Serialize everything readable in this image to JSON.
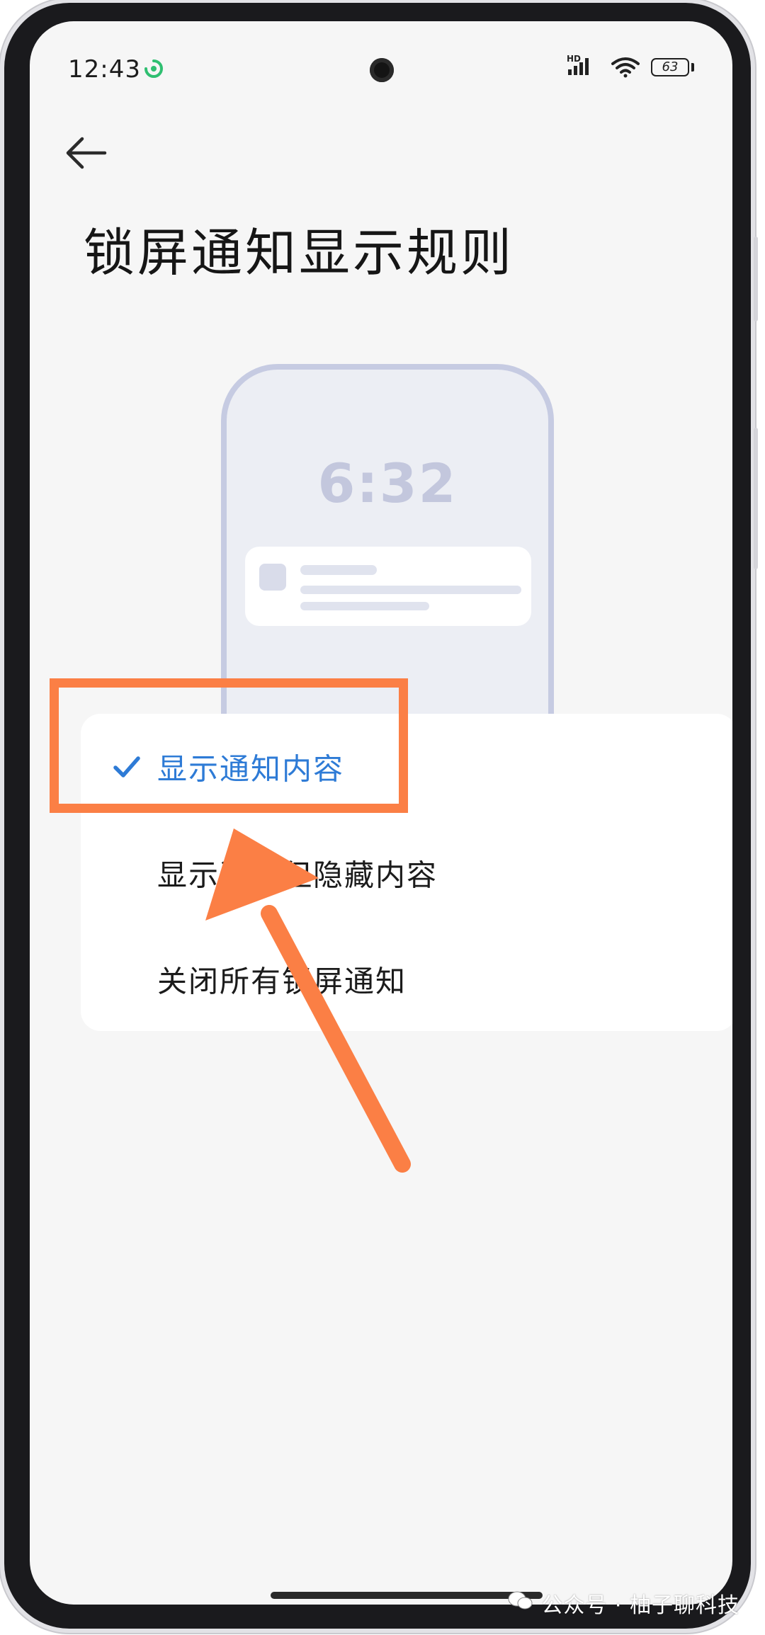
{
  "status_bar": {
    "time": "12:43",
    "network_label": "HD",
    "battery": "63"
  },
  "header": {
    "title": "锁屏通知显示规则"
  },
  "illustration": {
    "time": "6:32"
  },
  "options": [
    {
      "label": "显示通知内容",
      "selected": true
    },
    {
      "label": "显示通知但隐藏内容",
      "selected": false
    },
    {
      "label": "关闭所有锁屏通知",
      "selected": false
    }
  ],
  "watermark": {
    "text": "公众号 · 柚子聊科技"
  },
  "colors": {
    "accent": "#2e7bd6",
    "annotation": "#fb7f45",
    "app_icon": "#2fbf71"
  },
  "icons": {
    "back": "arrow-left-icon",
    "check": "checkmark-icon",
    "signal": "signal-icon",
    "wifi": "wifi-icon",
    "battery": "battery-icon",
    "app": "sync-app-icon"
  }
}
